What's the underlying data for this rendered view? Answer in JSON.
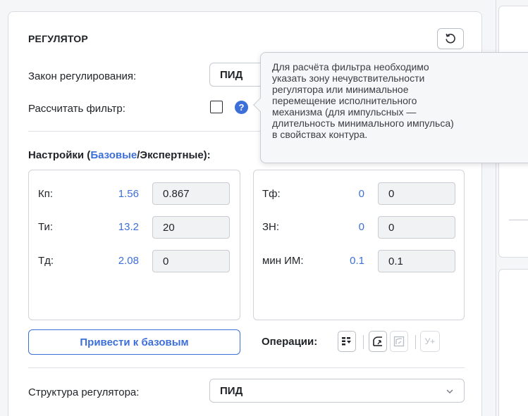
{
  "regulator": {
    "title": "РЕГУЛЯТОР",
    "law_label": "Закон регулирования:",
    "law_value": "ПИД",
    "filter_label": "Рассчитать фильтр:",
    "help_symbol": "?"
  },
  "tooltip": {
    "lines": [
      "Для расчёта фильтра необходимо",
      "указать зону нечувствительности",
      "регулятора или минимальное",
      "перемещение исполнительного",
      "механизма (для импульсных —",
      "длительность минимального импульса)",
      "в свойствах контура."
    ]
  },
  "settings": {
    "prefix": "Настройки (",
    "basic": "Базовые",
    "slash": "/",
    "expert": "Экспертные",
    "suffix": "):"
  },
  "params_left": [
    {
      "label": "Кп:",
      "base": "1.56",
      "value": "0.867"
    },
    {
      "label": "Ти:",
      "base": "13.2",
      "value": "20"
    },
    {
      "label": "Тд:",
      "base": "2.08",
      "value": "0"
    }
  ],
  "params_right": [
    {
      "label": "Тф:",
      "base": "0",
      "value": "0"
    },
    {
      "label": "ЗН:",
      "base": "0",
      "value": "0"
    },
    {
      "label": "мин ИМ:",
      "base": "0.1",
      "value": "0.1"
    }
  ],
  "actions": {
    "reset_base_label": "Привести к базовым",
    "operations_label": "Операции:",
    "y_plus": "У+"
  },
  "structure": {
    "label": "Структура регулятора:",
    "value": "ПИД"
  },
  "colors": {
    "accent": "#3d6fd8"
  }
}
